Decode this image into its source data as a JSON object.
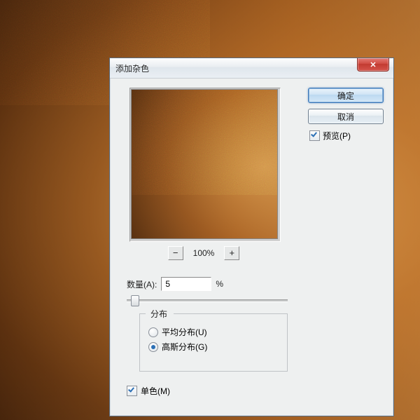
{
  "dialog": {
    "title": "添加杂色",
    "buttons": {
      "ok": "确定",
      "cancel": "取消"
    },
    "preview_checkbox_label": "预览(P)",
    "preview_checked": true,
    "zoom_label": "100%",
    "amount": {
      "label": "数量(A):",
      "value": "5",
      "suffix": "%"
    },
    "distribution": {
      "group_label": "分布",
      "options": [
        {
          "label": "平均分布(U)",
          "checked": false
        },
        {
          "label": "高斯分布(G)",
          "checked": true
        }
      ]
    },
    "monochrome": {
      "label": "单色(M)",
      "checked": true
    }
  }
}
